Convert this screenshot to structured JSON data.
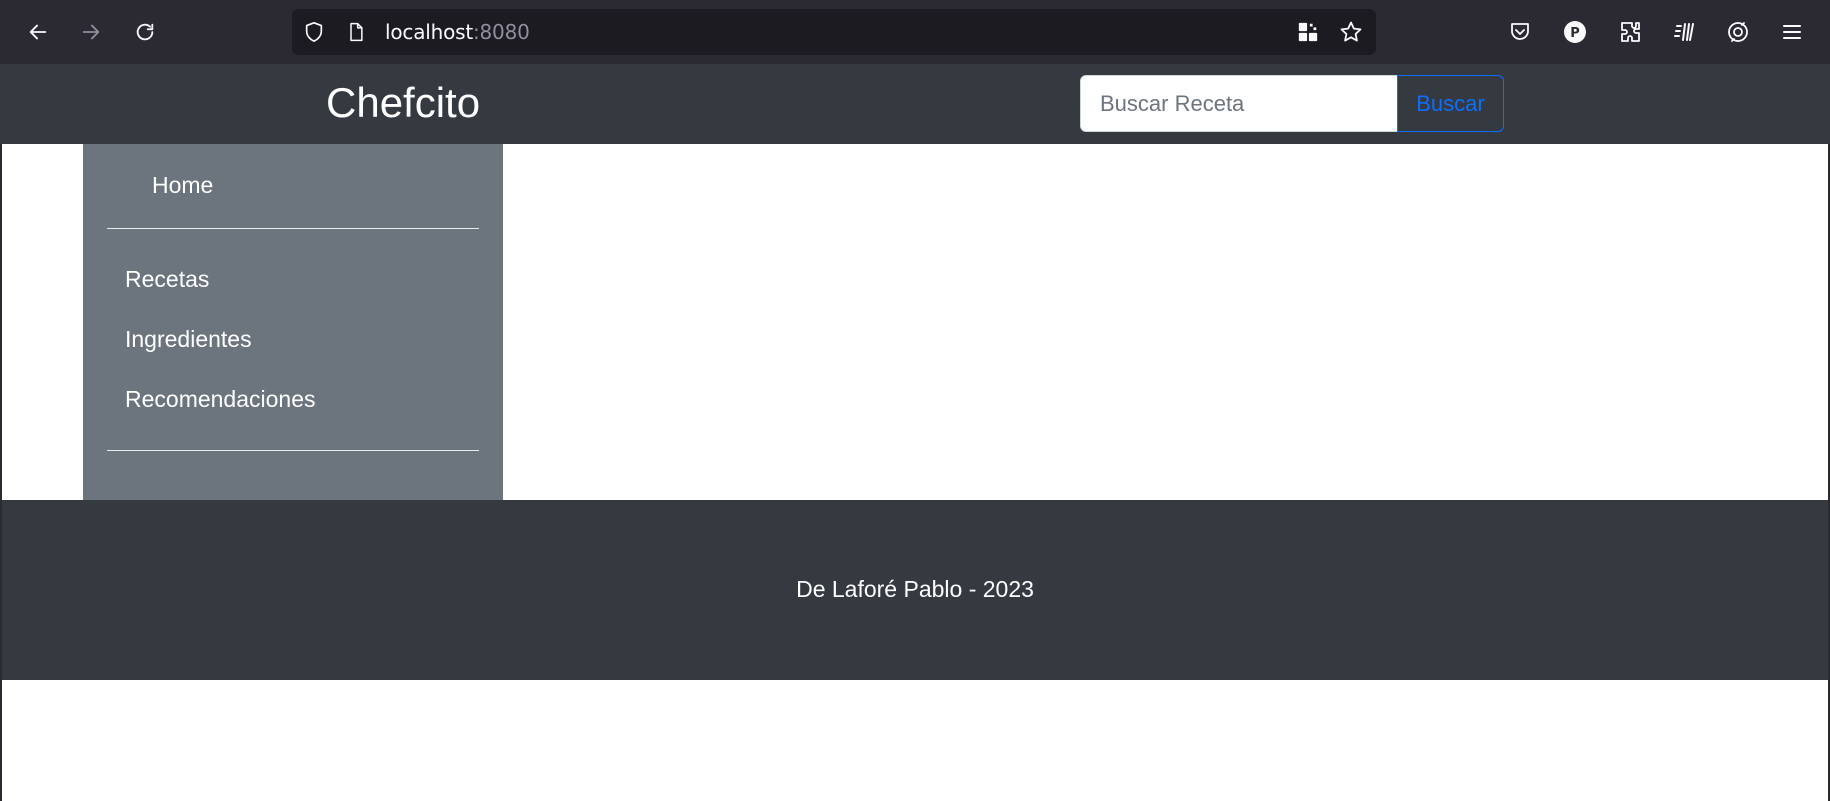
{
  "browser": {
    "url_host": "localhost",
    "url_port": ":8080",
    "icons": [
      "back-icon",
      "forward-icon",
      "reload-icon",
      "shield-icon",
      "page-icon",
      "qr-icon",
      "bookmark-star-icon",
      "pocket-icon",
      "profile-icon",
      "extensions-icon",
      "library-icon",
      "sync-icon",
      "menu-icon"
    ],
    "profile_initial": "P"
  },
  "header": {
    "brand": "Chefcito",
    "search_placeholder": "Buscar Receta",
    "search_button": "Buscar"
  },
  "sidebar": {
    "home": "Home",
    "items": [
      {
        "label": "Recetas"
      },
      {
        "label": "Ingredientes"
      },
      {
        "label": "Recomendaciones"
      }
    ]
  },
  "footer": {
    "text": "De Laforé Pablo - 2023"
  },
  "colors": {
    "header_bg": "#343a40",
    "sidebar_bg": "#6c757d",
    "primary": "#0d6efd",
    "browser_bg": "#2b2a33"
  }
}
